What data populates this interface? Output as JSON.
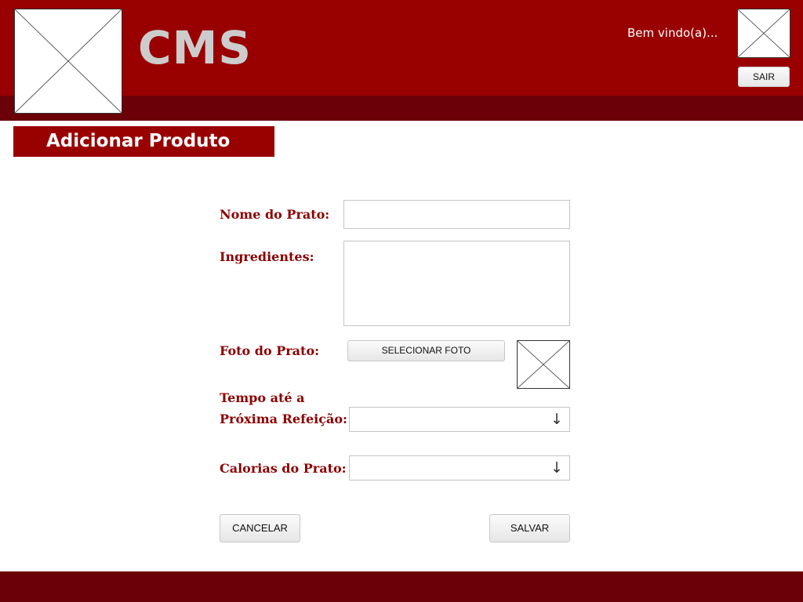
{
  "header": {
    "brand": "CMS",
    "welcome": "Bem vindo(a)...",
    "logout_label": "SAIR",
    "logo_icon": "image-placeholder-icon",
    "avatar_icon": "image-placeholder-icon"
  },
  "page": {
    "title": "Adicionar Produto"
  },
  "form": {
    "name_label": "Nome do Prato:",
    "name_value": "",
    "ingredients_label": "Ingredientes:",
    "ingredients_value": "",
    "photo_label": "Foto do Prato:",
    "photo_button": "SELECIONAR FOTO",
    "photo_preview_icon": "image-placeholder-icon",
    "time_label_line1": "Tempo até a",
    "time_label_line2": "Próxima Refeição:",
    "time_value": "",
    "calories_label": "Calorias do Prato:",
    "calories_value": "",
    "dropdown_icon": "arrow-down-icon",
    "cancel_label": "CANCELAR",
    "save_label": "SALVAR"
  },
  "colors": {
    "primary": "#990000",
    "dark": "#6b0008",
    "brand_text": "#cccccc",
    "label_text": "#8b0000"
  }
}
